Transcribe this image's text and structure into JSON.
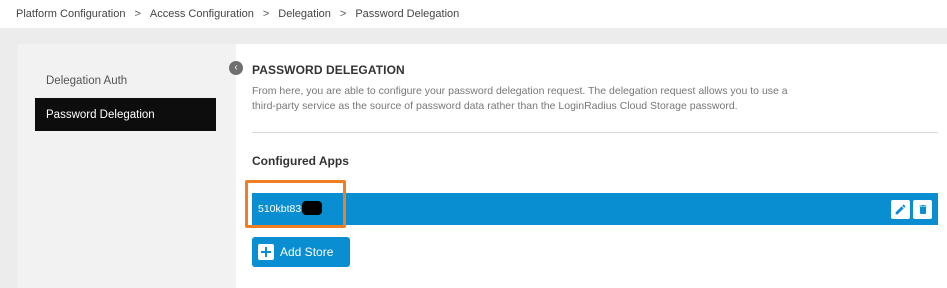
{
  "breadcrumb": {
    "items": [
      "Platform Configuration",
      "Access Configuration",
      "Delegation",
      "Password Delegation"
    ],
    "separator": ">"
  },
  "sidebar": {
    "items": [
      {
        "label": "Delegation Auth",
        "active": false
      },
      {
        "label": "Password Delegation",
        "active": true
      }
    ]
  },
  "main": {
    "title": "PASSWORD DELEGATION",
    "description": "From here, you are able to configure your password delegation request. The delegation request allows you to use a third-party service as the source of password data rather than the LoginRadius Cloud Storage password.",
    "configured_apps_title": "Configured Apps",
    "apps": [
      {
        "name": "510kbt83"
      }
    ],
    "add_store_label": "Add Store"
  },
  "icons": {
    "collapse": "chevron-left-icon",
    "edit": "pencil-icon",
    "delete": "trash-icon",
    "add": "plus-icon"
  },
  "colors": {
    "accent": "#0a8ed2",
    "highlight": "#f07f24",
    "sidebar_active": "#0d0d0d"
  }
}
